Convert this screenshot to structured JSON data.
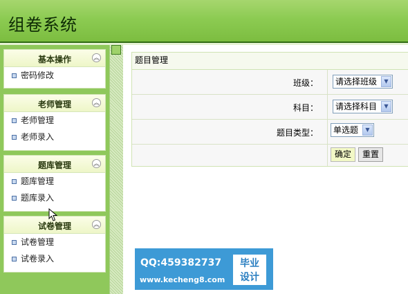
{
  "header": {
    "title": "组卷系统"
  },
  "sidebar": {
    "groups": [
      {
        "title": "基本操作",
        "items": [
          {
            "label": "密码修改"
          }
        ]
      },
      {
        "title": "老师管理",
        "items": [
          {
            "label": "老师管理"
          },
          {
            "label": "老师录入"
          }
        ]
      },
      {
        "title": "题库管理",
        "items": [
          {
            "label": "题库管理"
          },
          {
            "label": "题库录入"
          }
        ]
      },
      {
        "title": "试卷管理",
        "items": [
          {
            "label": "试卷管理"
          },
          {
            "label": "试卷录入"
          }
        ]
      }
    ],
    "collapse_icon": "double-chevron-up-icon"
  },
  "panel": {
    "title": "题目管理",
    "fields": [
      {
        "label": "班级：",
        "selected": "请选择班级"
      },
      {
        "label": "科目：",
        "selected": "请选择科目"
      },
      {
        "label": "题目类型：",
        "selected": "单选题"
      }
    ],
    "buttons": {
      "ok": "确定",
      "reset": "重置"
    }
  },
  "watermark": {
    "qq": "QQ:459382737",
    "url": "www.kecheng8.com",
    "tag_line1": "毕业",
    "tag_line2": "设计"
  },
  "colors": {
    "header_green": "#8ccb52",
    "sidebar_green": "#8fc85b",
    "watermark_blue": "#3d9ad6"
  }
}
